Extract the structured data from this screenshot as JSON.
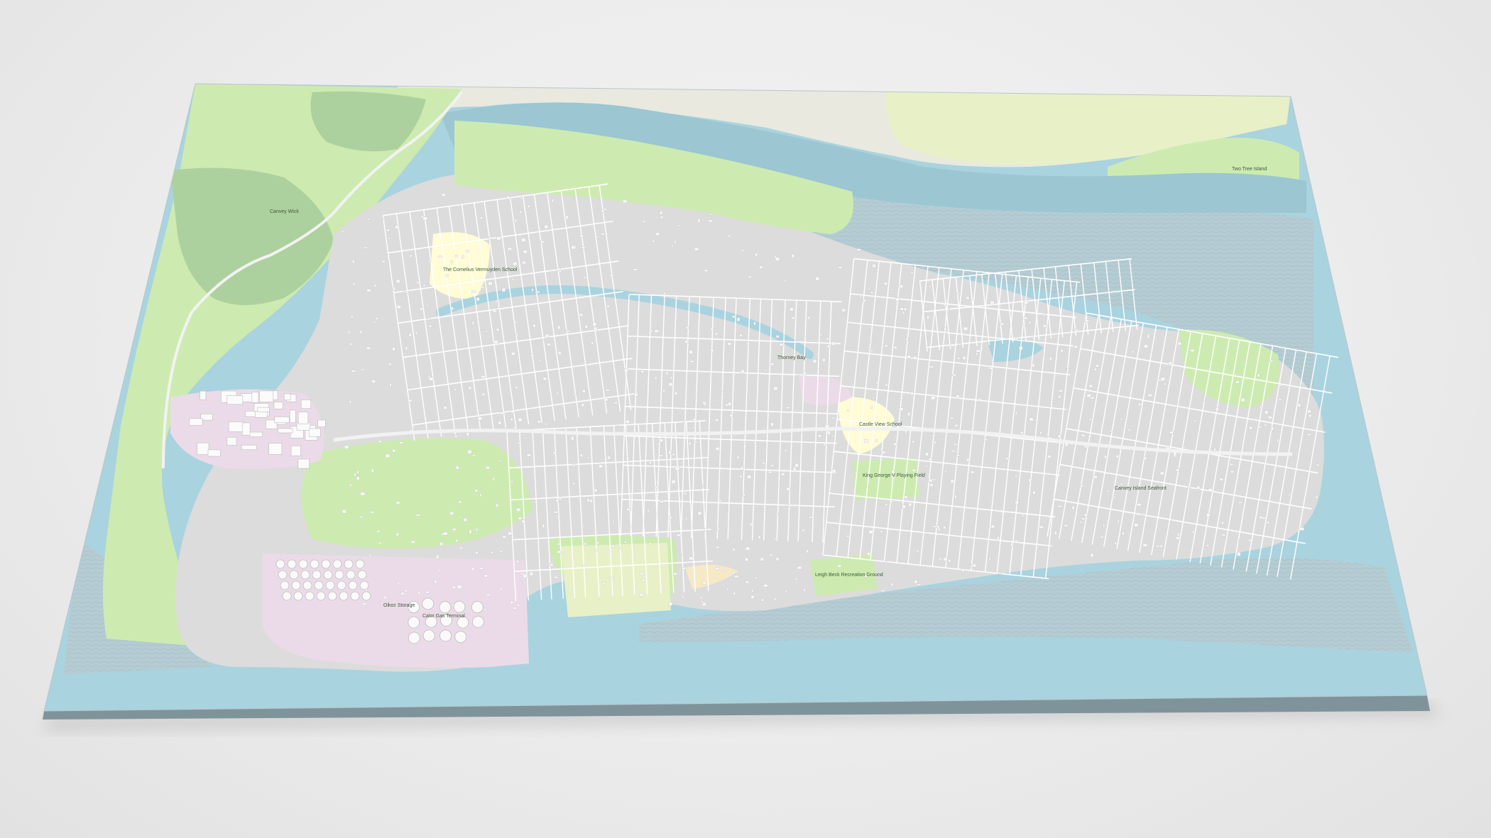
{
  "map": {
    "labels": {
      "school_north": "The Cornelius Vermuyden School",
      "school_east": "Canvey Island Seafront",
      "park_king_george": "King George V Playing Field",
      "rec_ground": "Leigh Beck Recreation Ground",
      "sports_field": "Castle View School",
      "thorney_bay": "Thorney Bay",
      "refinery": "Oikos Storage",
      "storage_terminal": "Calor Gas Terminal",
      "marshes": "Canvey Wick",
      "two_tree": "Two Tree Island"
    },
    "colors": {
      "water": "#a9d3df",
      "water_dark": "#9bc6d2",
      "mudflat": "#bcd0d6",
      "land": "#dcdcdc",
      "park": "#cdebb0",
      "wood": "#add19e",
      "industrial": "#ebdbe8",
      "school": "#fffcd6",
      "sand": "#f5e9c6",
      "road": "#ffffff",
      "building": "#f7f7f7",
      "board_edge": "#7f949a"
    }
  }
}
